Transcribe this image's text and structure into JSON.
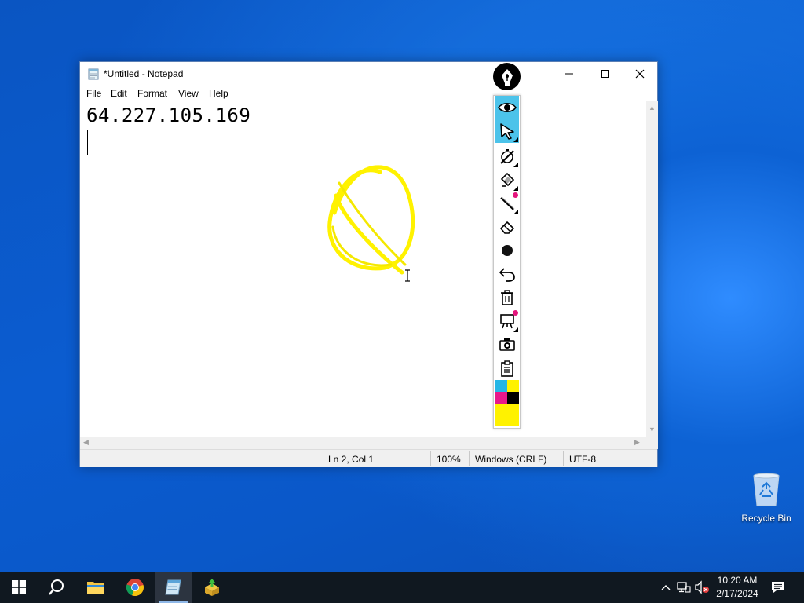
{
  "window": {
    "title": "*Untitled - Notepad",
    "menu": [
      "File",
      "Edit",
      "Format",
      "View",
      "Help"
    ]
  },
  "editor": {
    "lines": [
      "64.227.105.169",
      ""
    ]
  },
  "statusbar": {
    "position": "Ln 2, Col 1",
    "zoom": "100%",
    "line_ending": "Windows (CRLF)",
    "encoding": "UTF-8"
  },
  "annotation_toolbar": {
    "tools": [
      "eye-icon",
      "pointer-icon",
      "timer-pen-icon",
      "highlighter-icon",
      "line-icon",
      "eraser-icon",
      "dot-icon",
      "undo-icon",
      "trash-icon",
      "whiteboard-icon",
      "camera-icon",
      "clipboard-icon"
    ],
    "active_tools": [
      "eye-icon",
      "pointer-icon"
    ],
    "palette": [
      "#25b6e6",
      "#fff200",
      "#e8198a",
      "#000000"
    ],
    "current_color": "#fff200"
  },
  "desktop": {
    "icons": [
      {
        "label": "Recycle Bin",
        "icon": "recycle-bin-icon"
      }
    ]
  },
  "taskbar": {
    "apps": [
      "start-icon",
      "search-icon",
      "file-explorer-icon",
      "chrome-icon",
      "notepad-icon",
      "installer-icon"
    ],
    "clock": {
      "time": "10:20 AM",
      "date": "2/17/2024"
    }
  },
  "colors": {
    "accent": "#4cc3ea",
    "highlight": "#fff200",
    "taskbar": "#101820"
  }
}
